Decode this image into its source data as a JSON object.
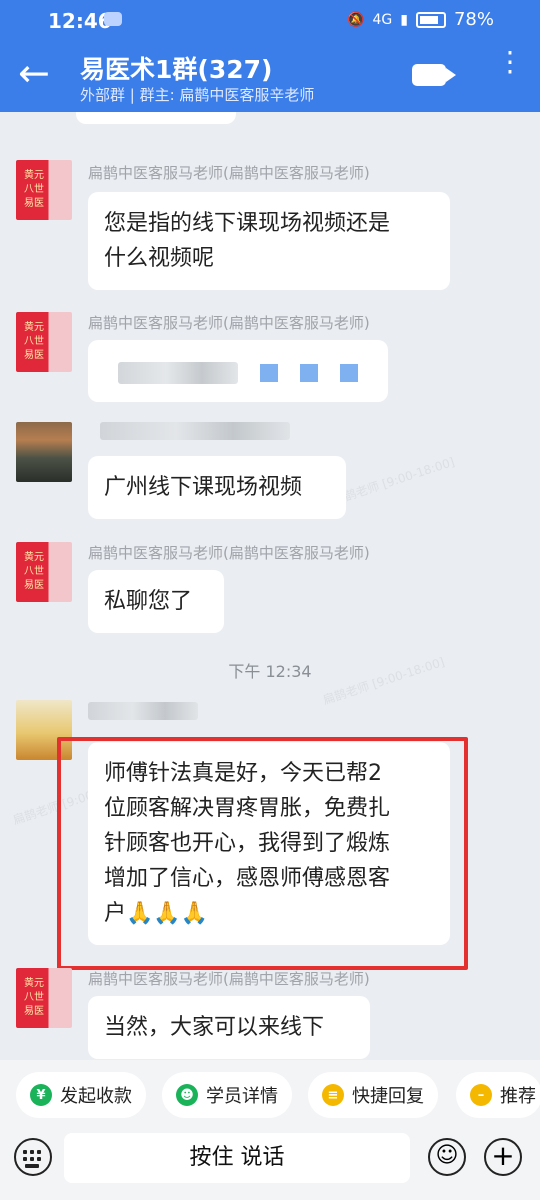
{
  "status": {
    "time": "12:46",
    "network": "4G",
    "battery": "78%"
  },
  "header": {
    "back_icon": "arrow-left-icon",
    "title": "易医术1群(327)",
    "subtitle": "外部群 | 群主: 扁鹊中医客服辛老师",
    "video_icon": "video-call-icon",
    "more_icon": "more-vertical-icon",
    "bg": "#3b7de9"
  },
  "messages": [
    {
      "sender": "扁鹊中医客服马老师(扁鹊中医客服马老师)",
      "text_lines": [
        "您是指的线下课现场视频还是",
        "什么视频呢"
      ]
    },
    {
      "sender": "扁鹊中医客服马老师(扁鹊中医客服马老师)",
      "text_lines": []
    },
    {
      "sender": "",
      "text_lines": [
        "广州线下课现场视频"
      ]
    },
    {
      "sender": "扁鹊中医客服马老师(扁鹊中医客服马老师)",
      "text_lines": [
        "私聊您了"
      ]
    },
    {
      "sender": "",
      "text_lines": [
        "师傅针法真是好，今天已帮2",
        "位顾客解决胃疼胃胀，免费扎",
        "针顾客也开心，我得到了煅炼",
        "增加了信心，感恩师傅感恩客",
        "户🙏🙏🙏"
      ]
    },
    {
      "sender": "扁鹊中医客服马老师(扁鹊中医客服马老师)",
      "text_lines": [
        "当然，大家可以来线下"
      ]
    }
  ],
  "time_separator": "下午 12:34",
  "quick_actions": [
    {
      "label": "发起收款",
      "icon": "yen-icon",
      "color": "#1bb35a"
    },
    {
      "label": "学员详情",
      "icon": "user-card-icon",
      "color": "#1bb35a"
    },
    {
      "label": "快捷回复",
      "icon": "quick-reply-icon",
      "color": "#f5b800"
    },
    {
      "label": "推荐",
      "icon": "recommend-icon",
      "color": "#f5b800"
    }
  ],
  "input": {
    "hold_to_talk": "按住 说话"
  },
  "colors": {
    "highlight": "#e53030",
    "chat_bg": "#eaedf1"
  }
}
